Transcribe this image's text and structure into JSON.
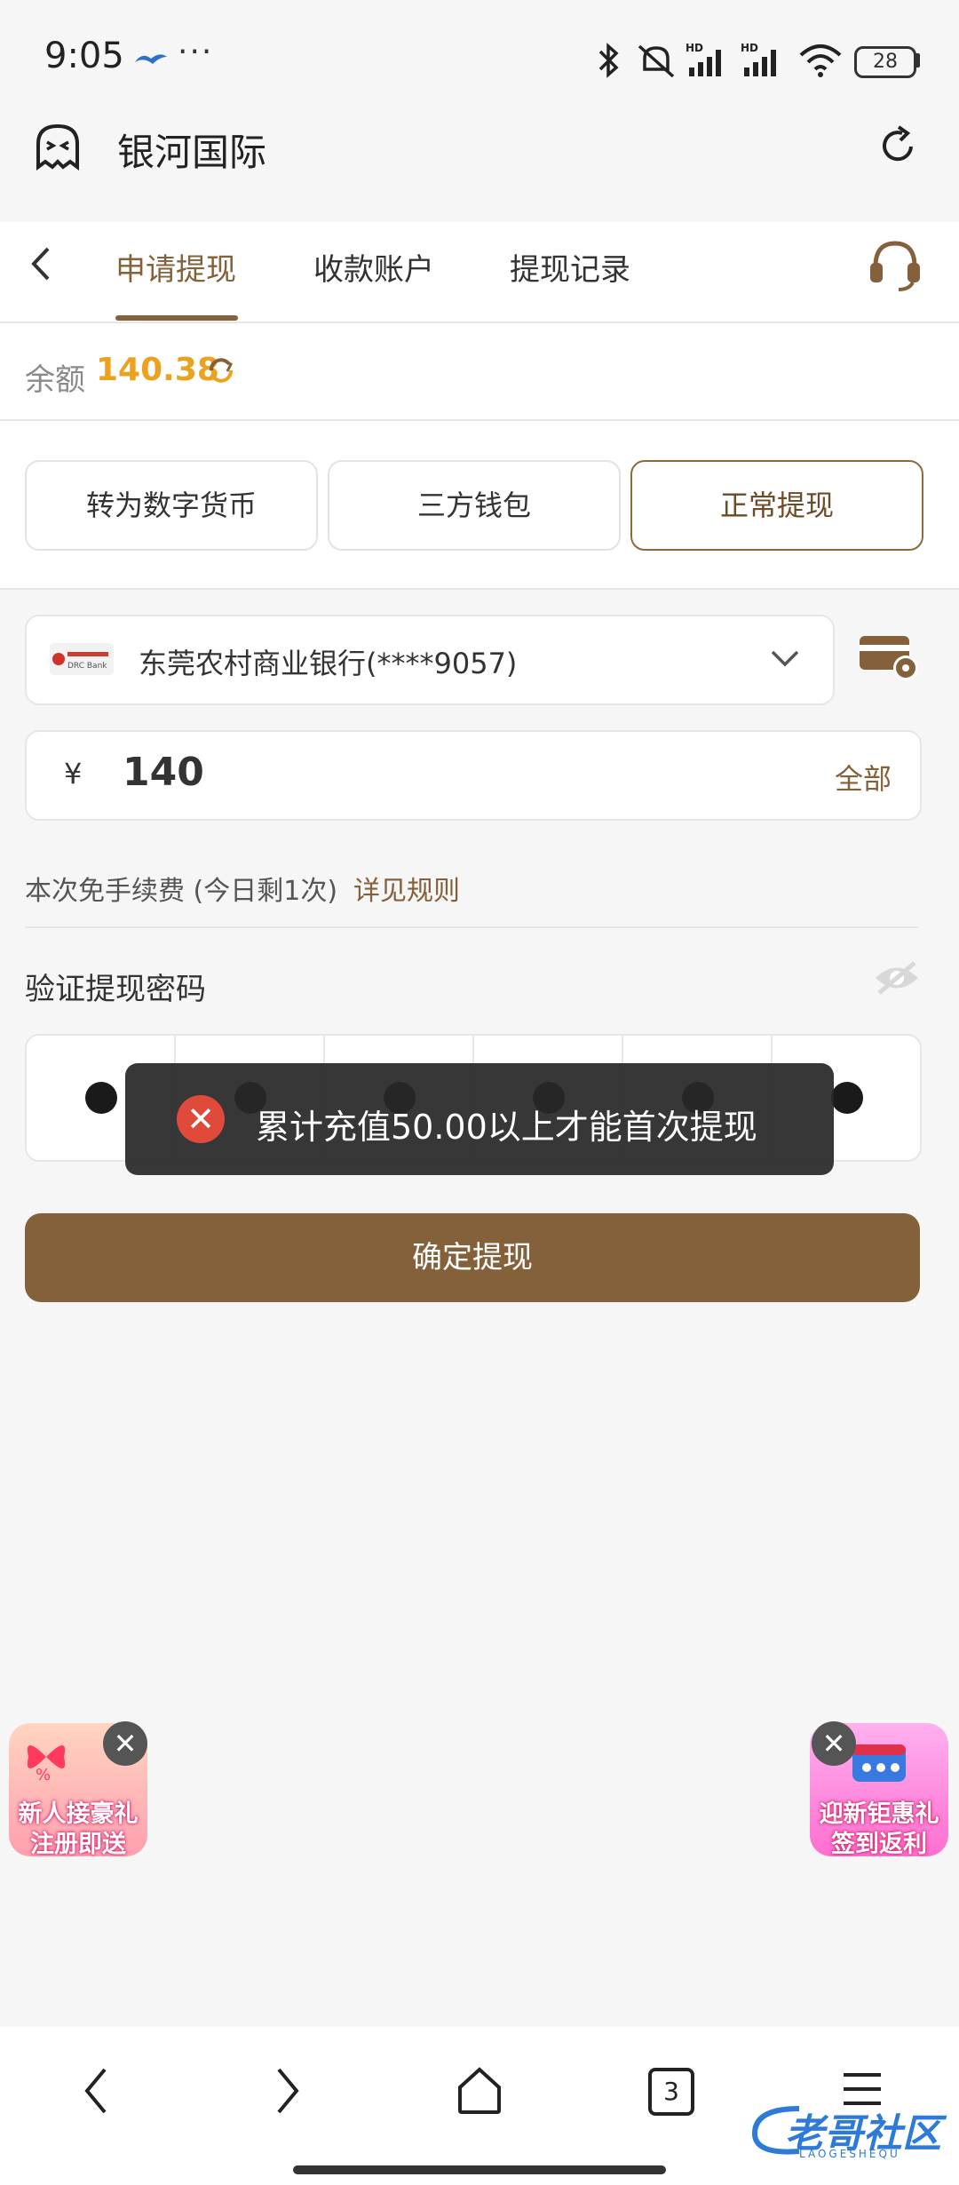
{
  "status_bar": {
    "time": "9:05",
    "dots": "···",
    "battery": "28",
    "icons": [
      "bird-icon",
      "bluetooth-icon",
      "mute-icon",
      "signal-hd-icon",
      "signal-hd-icon",
      "wifi-icon"
    ]
  },
  "browser": {
    "title": "银河国际",
    "left_icon": "ghost-icon",
    "right_icon": "refresh-icon"
  },
  "tabs": {
    "items": [
      {
        "label": "申请提现",
        "active": true
      },
      {
        "label": "收款账户",
        "active": false
      },
      {
        "label": "提现记录",
        "active": false
      }
    ],
    "back_icon": "chevron-left-icon",
    "support_icon": "headset-icon"
  },
  "balance": {
    "label": "余额",
    "value": "140.38",
    "refresh_icon": "refresh-icon"
  },
  "methods": [
    {
      "label": "转为数字货币",
      "active": false
    },
    {
      "label": "三方钱包",
      "active": false
    },
    {
      "label": "正常提现",
      "active": true
    }
  ],
  "bank": {
    "name": "东莞农村商业银行(****9057)",
    "logo_text": "DRC Bank",
    "dropdown_icon": "chevron-down-icon",
    "manage_icon": "card-settings-icon"
  },
  "amount": {
    "currency": "¥",
    "value": "140",
    "all_label": "全部"
  },
  "fee": {
    "text": "本次免手续费 (今日剩1次)",
    "rule_link": "详见规则"
  },
  "password": {
    "label": "验证提现密码",
    "visibility_icon": "eye-off-icon",
    "pin_count": 6
  },
  "toast": {
    "message": "累计充值50.00以上才能首次提现",
    "icon": "error-x-icon"
  },
  "confirm": {
    "label": "确定提现"
  },
  "promos": {
    "left": {
      "line1": "新人接豪礼",
      "line2": "注册即送"
    },
    "right": {
      "line1": "迎新钜惠礼",
      "line2": "签到返利"
    }
  },
  "bottom_nav": {
    "tab_count": "3",
    "watermark": "老哥社区",
    "watermark_sub": "LAOGESHEQU"
  },
  "colors": {
    "accent": "#84613a",
    "balance": "#e9a320",
    "toast_bg": "#282828",
    "error": "#e04a3a"
  }
}
